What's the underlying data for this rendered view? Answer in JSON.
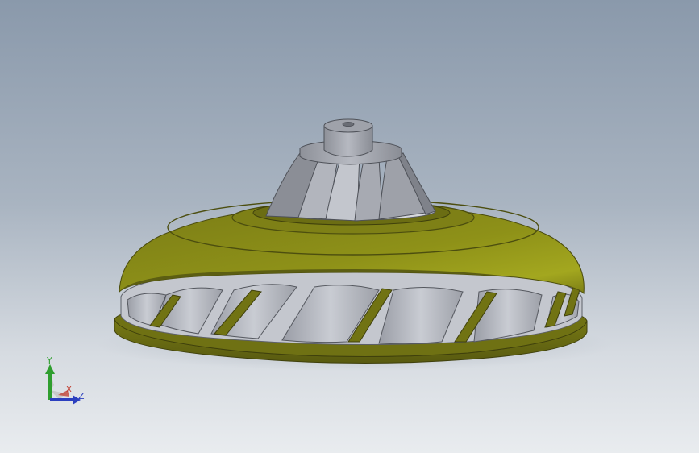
{
  "viewport": {
    "background_top": "#8a99ab",
    "background_bottom": "#e9ecef"
  },
  "model": {
    "shroud_color": "#6f7016",
    "shroud_highlight": "#9ea21e",
    "blade_color": "#b9bcc4",
    "hub_color": "#a2a5ad"
  },
  "triad": {
    "y_label": "Y",
    "x_label": "X",
    "z_label": "Z",
    "y_color": "#2f9e2f",
    "x_color": "#c0392b",
    "z_color": "#2b3fbf"
  }
}
